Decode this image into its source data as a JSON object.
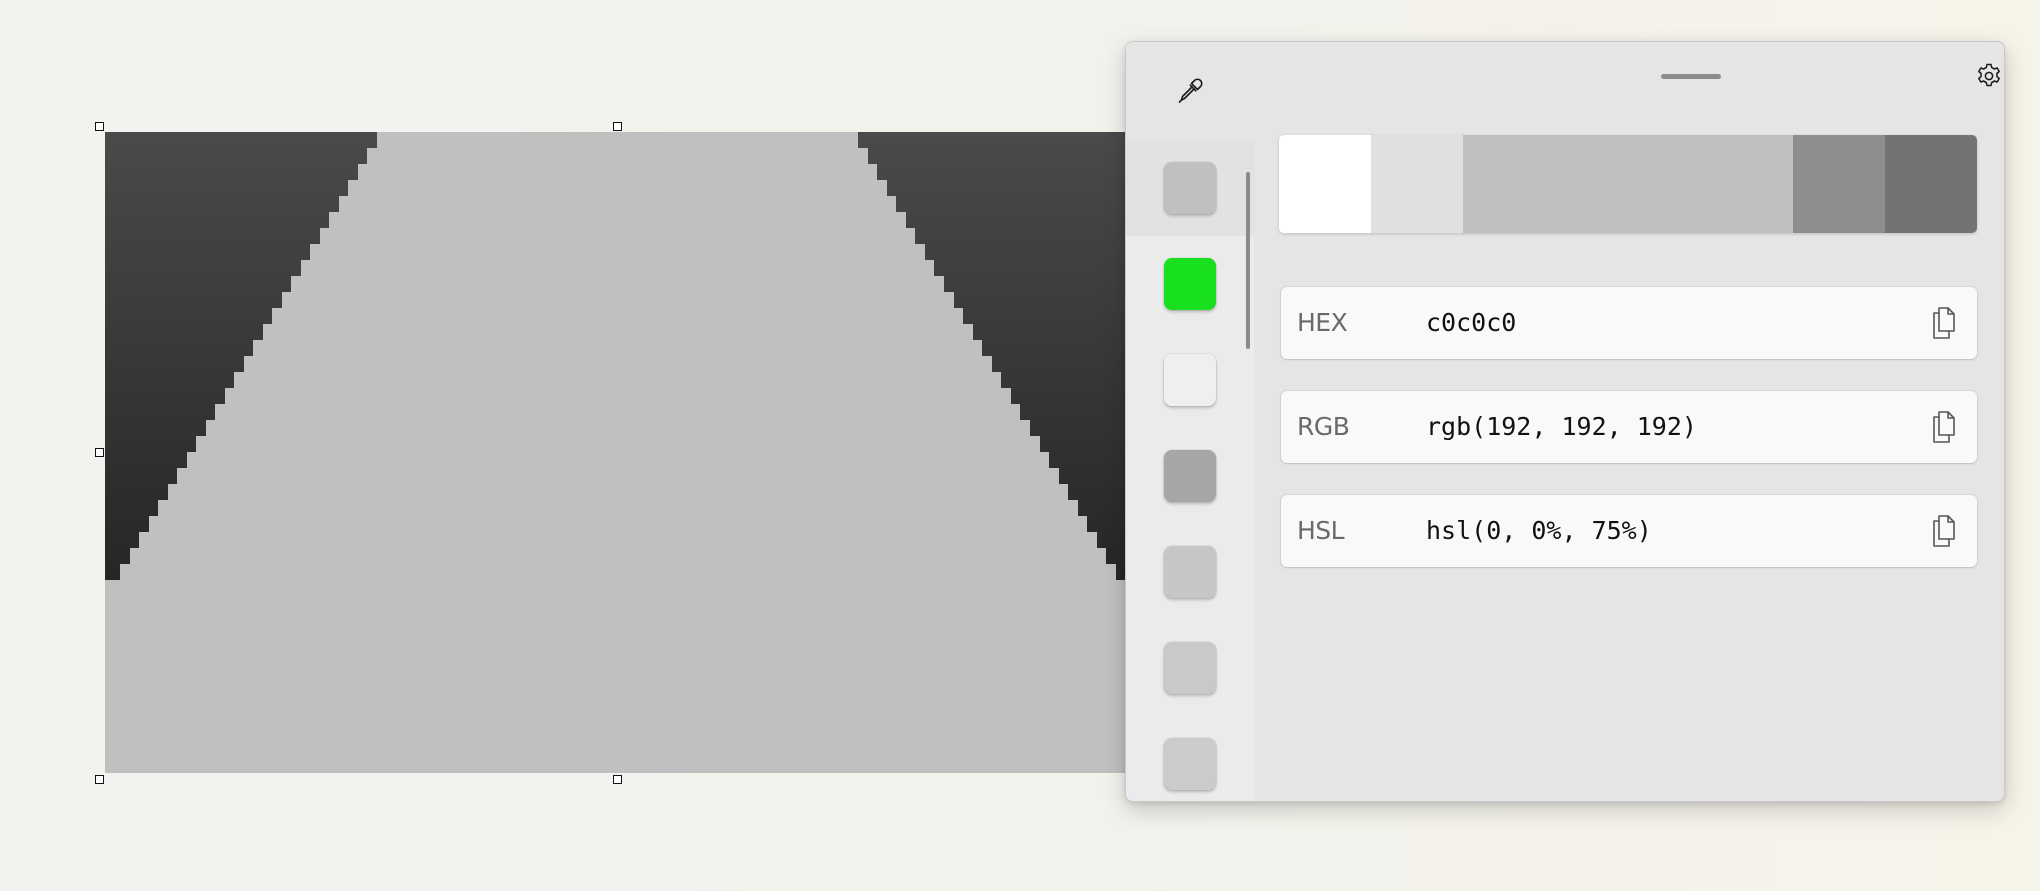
{
  "canvas": {
    "fill_color": "#c0c0c0",
    "dark_color": "#3a3a3a"
  },
  "picker": {
    "toolbar": {
      "eyedropper_icon": "eyedropper-icon",
      "settings_icon": "gear-icon",
      "close_icon": "close-icon"
    },
    "history": [
      {
        "color": "#c0c0c0",
        "selected": true
      },
      {
        "color": "#19e01f",
        "selected": false
      },
      {
        "color": "#efefef",
        "selected": false
      },
      {
        "color": "#a6a6a6",
        "selected": false
      },
      {
        "color": "#c6c6c6",
        "selected": false
      },
      {
        "color": "#c9c9c9",
        "selected": false
      },
      {
        "color": "#cbcbcb",
        "selected": false
      }
    ],
    "shades": [
      {
        "color": "#ffffff",
        "weight": 1
      },
      {
        "color": "#e0e0e0",
        "weight": 1
      },
      {
        "color": "#c0c0c0",
        "weight": 3.6
      },
      {
        "color": "#8e8e8e",
        "weight": 1
      },
      {
        "color": "#737373",
        "weight": 1
      }
    ],
    "formats": [
      {
        "label": "HEX",
        "value": "c0c0c0"
      },
      {
        "label": "RGB",
        "value": "rgb(192, 192, 192)"
      },
      {
        "label": "HSL",
        "value": "hsl(0, 0%, 75%)"
      }
    ]
  }
}
